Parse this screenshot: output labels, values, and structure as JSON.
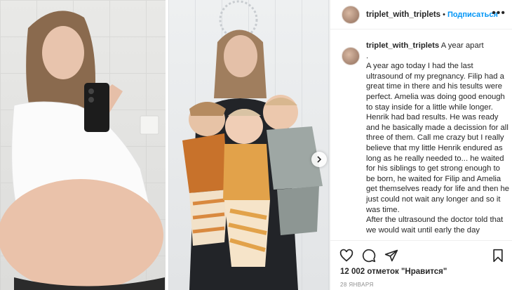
{
  "post": {
    "username": "triplet_with_triplets",
    "separator": "•",
    "follow_label": "Подписаться",
    "more_label": "•••"
  },
  "caption": {
    "username": "triplet_with_triplets",
    "text": "A year apart\n.\nA year ago today I had the last ultrasound of my pregnancy. Filip had a great time in there and his tesults were perfect. Amelia was doing good enough to stay inside for a little while longer. Henrik had bad results. He was ready and he basically made a decission for all three of them. Call me crazy but I really believe that my little Henrik endured as long as he really needed to... he waited for his siblings to get strong enough to be born, he waited for Filip and Amelia get themselves ready for life and then he just could not wait any longer and so it was time.\nAfter the ultrasound the doctor told that we would wait until early the day"
  },
  "stats": {
    "likes": "12 002 отметок \"Нравится\"",
    "date": "28 января"
  },
  "icons": {
    "like": "heart-icon",
    "comment": "comment-icon",
    "share": "share-icon",
    "save": "bookmark-icon",
    "next": "chevron-right-icon"
  },
  "colors": {
    "link": "#0095f6",
    "text": "#262626",
    "muted": "#8e8e8e",
    "border": "#efefef"
  }
}
